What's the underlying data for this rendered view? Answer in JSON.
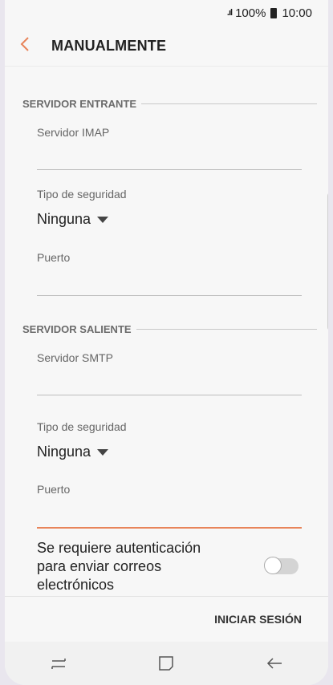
{
  "status": {
    "signal": ".ıl",
    "battery": "100%",
    "time": "10:00"
  },
  "header": {
    "title": "MANUALMENTE"
  },
  "incoming": {
    "section_title": "SERVIDOR ENTRANTE",
    "server_label": "Servidor IMAP",
    "server_value": "",
    "security_label": "Tipo de seguridad",
    "security_value": "Ninguna",
    "port_label": "Puerto",
    "port_value": ""
  },
  "outgoing": {
    "section_title": "SERVIDOR SALIENTE",
    "server_label": "Servidor SMTP",
    "server_value": "",
    "security_label": "Tipo de seguridad",
    "security_value": "Ninguna",
    "port_label": "Puerto",
    "port_value": ""
  },
  "auth": {
    "label": "Se requiere autenticación para enviar correos electrónicos",
    "enabled": false
  },
  "footer": {
    "signin_label": "INICIAR SESIÓN"
  },
  "colors": {
    "accent": "#e8845a"
  }
}
